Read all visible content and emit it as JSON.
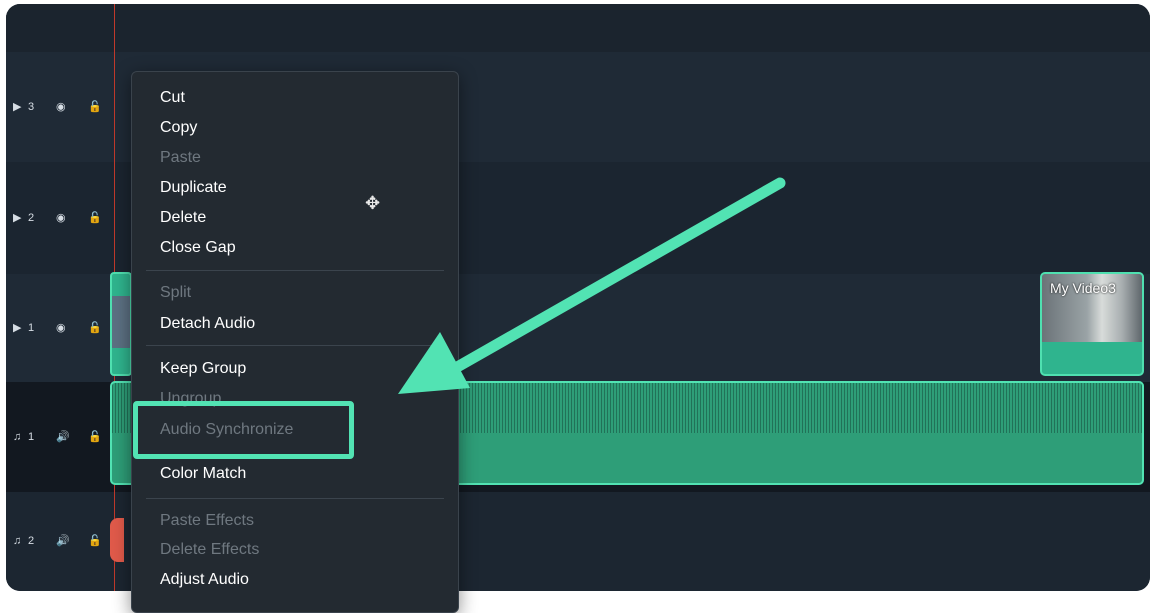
{
  "tracks": [
    {
      "kind": "video",
      "number": "3",
      "type_icon": "video-track-icon",
      "vis_icon": "eye-icon"
    },
    {
      "kind": "video",
      "number": "2",
      "type_icon": "video-track-icon",
      "vis_icon": "eye-icon"
    },
    {
      "kind": "video",
      "number": "1",
      "type_icon": "video-track-icon",
      "vis_icon": "eye-icon"
    },
    {
      "kind": "audio",
      "number": "1",
      "type_icon": "music-note-icon",
      "vis_icon": "speaker-icon"
    },
    {
      "kind": "audio",
      "number": "2",
      "type_icon": "music-note-icon",
      "vis_icon": "speaker-icon"
    }
  ],
  "clips": {
    "right_clip_title": "My Video3"
  },
  "context_menu": {
    "items": [
      {
        "label": "Cut",
        "enabled": true
      },
      {
        "label": "Copy",
        "enabled": true
      },
      {
        "label": "Paste",
        "enabled": false
      },
      {
        "label": "Duplicate",
        "enabled": true
      },
      {
        "label": "Delete",
        "enabled": true
      },
      {
        "label": "Close Gap",
        "enabled": true
      },
      {
        "label": "Split",
        "enabled": false
      },
      {
        "label": "Detach Audio",
        "enabled": true
      },
      {
        "label": "Keep Group",
        "enabled": true
      },
      {
        "label": "Ungroup",
        "enabled": false
      },
      {
        "label": "Audio Synchronize",
        "enabled": false
      },
      {
        "label": "Color Match",
        "enabled": true
      },
      {
        "label": "Paste Effects",
        "enabled": false
      },
      {
        "label": "Delete Effects",
        "enabled": false
      },
      {
        "label": "Adjust Audio",
        "enabled": true
      }
    ]
  },
  "colors": {
    "accent": "#52e3b3",
    "audio_clip": "#2e9e78",
    "playhead": "#c0392b"
  }
}
